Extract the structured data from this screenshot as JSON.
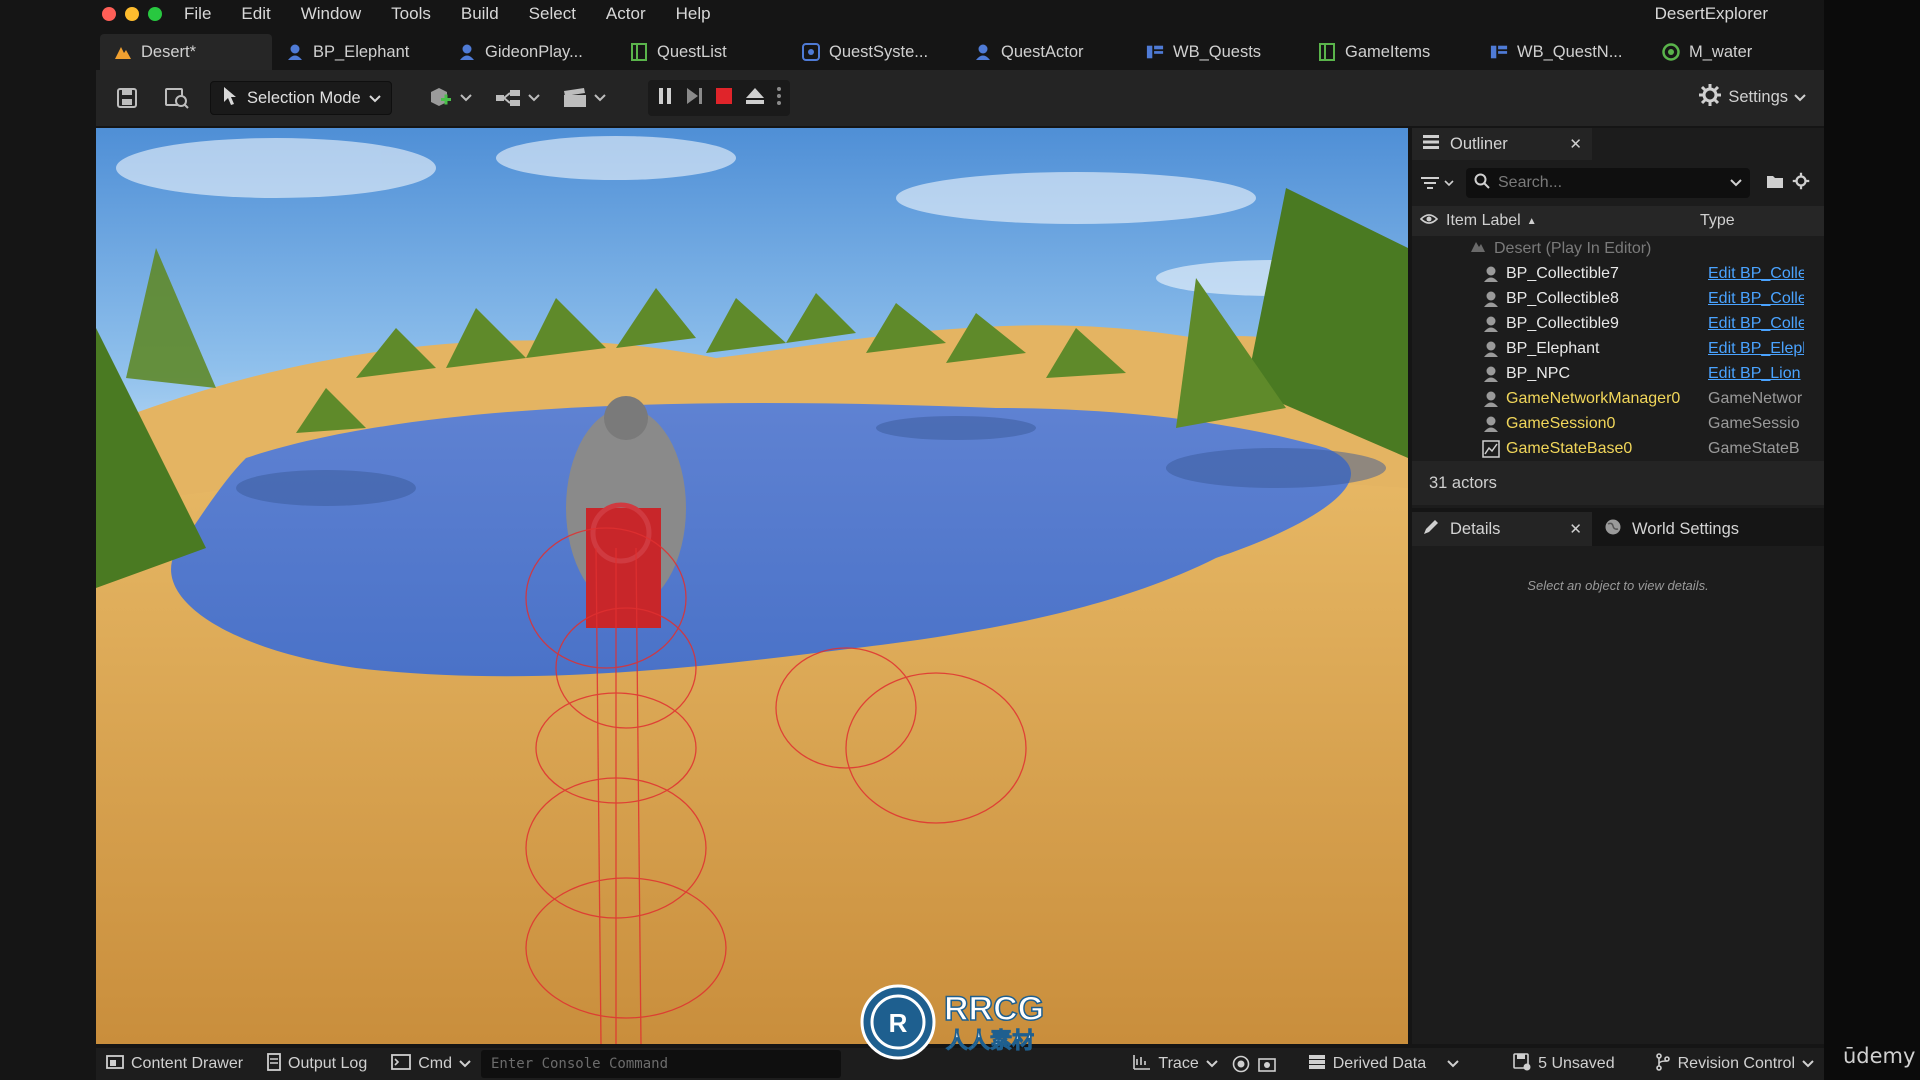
{
  "menu": {
    "items": [
      "File",
      "Edit",
      "Window",
      "Tools",
      "Build",
      "Select",
      "Actor",
      "Help"
    ],
    "app_name": "DesertExplorer",
    "traffic_colors": [
      "#fe5f57",
      "#febc2e",
      "#28c840"
    ]
  },
  "tabs": [
    {
      "label": "Desert*",
      "icon": "level-icon",
      "color": "#f0a030"
    },
    {
      "label": "BP_Elephant",
      "icon": "blueprint-icon",
      "color": "#4f7bd6"
    },
    {
      "label": "GideonPlay...",
      "icon": "blueprint-icon",
      "color": "#4f7bd6"
    },
    {
      "label": "QuestList",
      "icon": "struct-icon",
      "color": "#5ab44b"
    },
    {
      "label": "QuestSyste...",
      "icon": "component-icon",
      "color": "#4f7bd6"
    },
    {
      "label": "QuestActor",
      "icon": "blueprint-icon",
      "color": "#4f7bd6"
    },
    {
      "label": "WB_Quests",
      "icon": "widget-icon",
      "color": "#4f7bd6"
    },
    {
      "label": "GameItems",
      "icon": "struct-icon",
      "color": "#5ab44b"
    },
    {
      "label": "WB_QuestN...",
      "icon": "widget-icon",
      "color": "#4f7bd6"
    },
    {
      "label": "M_water",
      "icon": "material-icon",
      "color": "#5ab44b"
    }
  ],
  "toolbar": {
    "mode_label": "Selection Mode",
    "settings_label": "Settings",
    "stop_color": "#e0242a"
  },
  "outliner": {
    "title": "Outliner",
    "search_placeholder": "Search...",
    "col_label": "Item Label",
    "col_type": "Type",
    "root": "Desert (Play In Editor)",
    "rows": [
      {
        "label": "BP_Collectible7",
        "type": "Edit BP_Colle",
        "link": true,
        "yellow": false
      },
      {
        "label": "BP_Collectible8",
        "type": "Edit BP_Colle",
        "link": true,
        "yellow": false
      },
      {
        "label": "BP_Collectible9",
        "type": "Edit BP_Colle",
        "link": true,
        "yellow": false
      },
      {
        "label": "BP_Elephant",
        "type": "Edit BP_Elepl",
        "link": true,
        "yellow": false
      },
      {
        "label": "BP_NPC",
        "type": "Edit BP_Lion",
        "link": true,
        "yellow": false
      },
      {
        "label": "GameNetworkManager0",
        "type": "GameNetwor",
        "link": false,
        "yellow": true
      },
      {
        "label": "GameSession0",
        "type": "GameSessio",
        "link": false,
        "yellow": true
      },
      {
        "label": "GameStateBase0",
        "type": "GameStateB",
        "link": false,
        "yellow": true
      }
    ],
    "actor_count": "31 actors"
  },
  "details": {
    "title": "Details",
    "world_settings": "World Settings",
    "hint": "Select an object to view details."
  },
  "status": {
    "content_drawer": "Content Drawer",
    "output_log": "Output Log",
    "cmd": "Cmd",
    "console_placeholder": "Enter Console Command",
    "trace": "Trace",
    "derived_data": "Derived Data",
    "unsaved": "5 Unsaved",
    "revision_control": "Revision Control"
  },
  "watermark": {
    "text": "RRCG",
    "sub": "人人素材"
  },
  "brand": "ūdemy"
}
